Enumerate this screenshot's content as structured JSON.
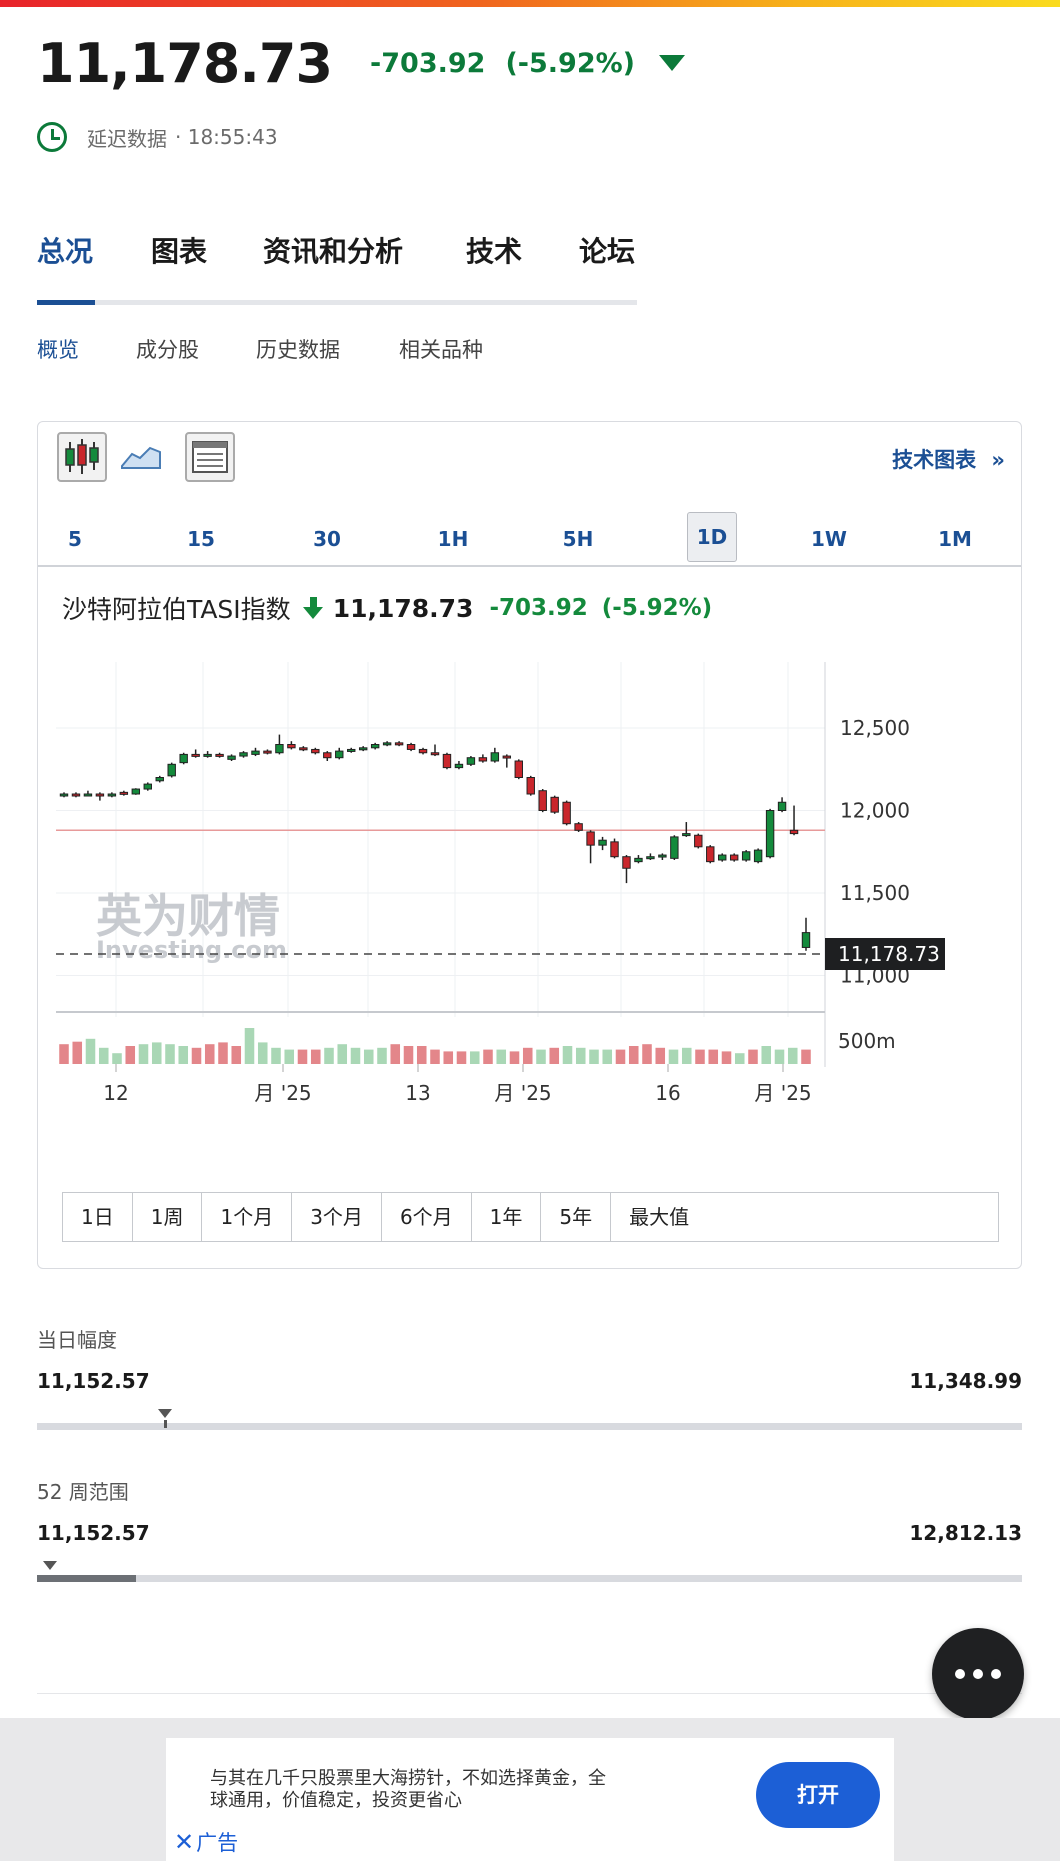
{
  "header": {
    "price": "11,178.73",
    "change": "-703.92",
    "change_pct": "(-5.92%)",
    "delay_label": "延迟数据",
    "time": "· 18:55:43"
  },
  "main_tabs": [
    "总况",
    "图表",
    "资讯和分析",
    "技术",
    "论坛"
  ],
  "sub_tabs": [
    "概览",
    "成分股",
    "历史数据",
    "相关品种"
  ],
  "chart_toolbar": {
    "tech_chart_label": "技术图表",
    "intervals": [
      "5",
      "15",
      "30",
      "1H",
      "5H",
      "1D",
      "1W",
      "1M"
    ],
    "selected_interval": "1D"
  },
  "chart_header": {
    "name": "沙特阿拉伯TASI指数",
    "price": "11,178.73",
    "change": "-703.92",
    "change_pct": "(-5.92%)"
  },
  "ranges": [
    "1日",
    "1周",
    "1个月",
    "3个月",
    "6个月",
    "1年",
    "5年",
    "最大值"
  ],
  "chart_data": {
    "type": "candlestick",
    "y_ticks": [
      "12,500",
      "12,000",
      "11,500",
      "11,000"
    ],
    "volume_tick": "500m",
    "x_ticks": [
      "12",
      "月 '25",
      "13",
      "月 '25",
      "16",
      "月 '25"
    ],
    "current_price_label": "11,178.73",
    "reference_line": 11880,
    "ylim": [
      10900,
      12900
    ],
    "candles": [
      {
        "o": 12090,
        "c": 12100,
        "h": 12110,
        "l": 12080
      },
      {
        "o": 12100,
        "c": 12090,
        "h": 12110,
        "l": 12080
      },
      {
        "o": 12095,
        "c": 12100,
        "h": 12120,
        "l": 12090
      },
      {
        "o": 12100,
        "c": 12090,
        "h": 12110,
        "l": 12060
      },
      {
        "o": 12090,
        "c": 12100,
        "h": 12110,
        "l": 12080
      },
      {
        "o": 12110,
        "c": 12100,
        "h": 12120,
        "l": 12090
      },
      {
        "o": 12100,
        "c": 12130,
        "h": 12135,
        "l": 12095
      },
      {
        "o": 12130,
        "c": 12160,
        "h": 12170,
        "l": 12120
      },
      {
        "o": 12180,
        "c": 12200,
        "h": 12210,
        "l": 12170
      },
      {
        "o": 12210,
        "c": 12280,
        "h": 12290,
        "l": 12200
      },
      {
        "o": 12290,
        "c": 12340,
        "h": 12350,
        "l": 12280
      },
      {
        "o": 12340,
        "c": 12330,
        "h": 12370,
        "l": 12320
      },
      {
        "o": 12330,
        "c": 12340,
        "h": 12360,
        "l": 12320
      },
      {
        "o": 12340,
        "c": 12330,
        "h": 12350,
        "l": 12320
      },
      {
        "o": 12310,
        "c": 12330,
        "h": 12340,
        "l": 12300
      },
      {
        "o": 12330,
        "c": 12350,
        "h": 12360,
        "l": 12320
      },
      {
        "o": 12340,
        "c": 12360,
        "h": 12380,
        "l": 12330
      },
      {
        "o": 12360,
        "c": 12350,
        "h": 12370,
        "l": 12340
      },
      {
        "o": 12350,
        "c": 12400,
        "h": 12460,
        "l": 12340
      },
      {
        "o": 12400,
        "c": 12380,
        "h": 12420,
        "l": 12370
      },
      {
        "o": 12380,
        "c": 12370,
        "h": 12390,
        "l": 12360
      },
      {
        "o": 12370,
        "c": 12350,
        "h": 12380,
        "l": 12340
      },
      {
        "o": 12350,
        "c": 12320,
        "h": 12360,
        "l": 12300
      },
      {
        "o": 12320,
        "c": 12360,
        "h": 12380,
        "l": 12310
      },
      {
        "o": 12360,
        "c": 12370,
        "h": 12380,
        "l": 12350
      },
      {
        "o": 12370,
        "c": 12380,
        "h": 12390,
        "l": 12360
      },
      {
        "o": 12380,
        "c": 12400,
        "h": 12410,
        "l": 12370
      },
      {
        "o": 12400,
        "c": 12410,
        "h": 12420,
        "l": 12390
      },
      {
        "o": 12410,
        "c": 12400,
        "h": 12420,
        "l": 12390
      },
      {
        "o": 12400,
        "c": 12370,
        "h": 12410,
        "l": 12360
      },
      {
        "o": 12370,
        "c": 12350,
        "h": 12380,
        "l": 12340
      },
      {
        "o": 12350,
        "c": 12340,
        "h": 12400,
        "l": 12330
      },
      {
        "o": 12340,
        "c": 12260,
        "h": 12350,
        "l": 12250
      },
      {
        "o": 12260,
        "c": 12280,
        "h": 12300,
        "l": 12250
      },
      {
        "o": 12280,
        "c": 12320,
        "h": 12330,
        "l": 12270
      },
      {
        "o": 12320,
        "c": 12300,
        "h": 12340,
        "l": 12290
      },
      {
        "o": 12300,
        "c": 12350,
        "h": 12380,
        "l": 12290
      },
      {
        "o": 12330,
        "c": 12320,
        "h": 12340,
        "l": 12260
      },
      {
        "o": 12300,
        "c": 12200,
        "h": 12310,
        "l": 12190
      },
      {
        "o": 12200,
        "c": 12100,
        "h": 12210,
        "l": 12090
      },
      {
        "o": 12120,
        "c": 12000,
        "h": 12130,
        "l": 11990
      },
      {
        "o": 12080,
        "c": 11990,
        "h": 12090,
        "l": 11980
      },
      {
        "o": 12050,
        "c": 11920,
        "h": 12060,
        "l": 11910
      },
      {
        "o": 11920,
        "c": 11880,
        "h": 11930,
        "l": 11870
      },
      {
        "o": 11870,
        "c": 11790,
        "h": 11880,
        "l": 11680
      },
      {
        "o": 11790,
        "c": 11820,
        "h": 11840,
        "l": 11760
      },
      {
        "o": 11810,
        "c": 11720,
        "h": 11830,
        "l": 11710
      },
      {
        "o": 11720,
        "c": 11650,
        "h": 11730,
        "l": 11560
      },
      {
        "o": 11690,
        "c": 11710,
        "h": 11730,
        "l": 11680
      },
      {
        "o": 11710,
        "c": 11720,
        "h": 11740,
        "l": 11700
      },
      {
        "o": 11720,
        "c": 11730,
        "h": 11740,
        "l": 11700
      },
      {
        "o": 11710,
        "c": 11840,
        "h": 11850,
        "l": 11700
      },
      {
        "o": 11850,
        "c": 11860,
        "h": 11930,
        "l": 11840
      },
      {
        "o": 11850,
        "c": 11780,
        "h": 11860,
        "l": 11770
      },
      {
        "o": 11780,
        "c": 11690,
        "h": 11790,
        "l": 11680
      },
      {
        "o": 11700,
        "c": 11730,
        "h": 11740,
        "l": 11690
      },
      {
        "o": 11730,
        "c": 11700,
        "h": 11740,
        "l": 11690
      },
      {
        "o": 11700,
        "c": 11750,
        "h": 11760,
        "l": 11690
      },
      {
        "o": 11690,
        "c": 11760,
        "h": 11770,
        "l": 11680
      },
      {
        "o": 11720,
        "c": 12000,
        "h": 12010,
        "l": 11710
      },
      {
        "o": 12000,
        "c": 12050,
        "h": 12080,
        "l": 11990
      },
      {
        "o": 11880,
        "c": 11860,
        "h": 12030,
        "l": 11850
      },
      {
        "o": 11170,
        "c": 11260,
        "h": 11350,
        "l": 11150
      }
    ],
    "volumes": [
      {
        "v": 0.55,
        "up": false
      },
      {
        "v": 0.62,
        "up": false
      },
      {
        "v": 0.7,
        "up": true
      },
      {
        "v": 0.45,
        "up": true
      },
      {
        "v": 0.3,
        "up": true
      },
      {
        "v": 0.5,
        "up": false
      },
      {
        "v": 0.55,
        "up": true
      },
      {
        "v": 0.6,
        "up": true
      },
      {
        "v": 0.55,
        "up": true
      },
      {
        "v": 0.5,
        "up": true
      },
      {
        "v": 0.45,
        "up": false
      },
      {
        "v": 0.55,
        "up": false
      },
      {
        "v": 0.6,
        "up": false
      },
      {
        "v": 0.5,
        "up": false
      },
      {
        "v": 1.0,
        "up": true
      },
      {
        "v": 0.6,
        "up": true
      },
      {
        "v": 0.45,
        "up": true
      },
      {
        "v": 0.4,
        "up": true
      },
      {
        "v": 0.4,
        "up": false
      },
      {
        "v": 0.4,
        "up": false
      },
      {
        "v": 0.45,
        "up": true
      },
      {
        "v": 0.55,
        "up": true
      },
      {
        "v": 0.45,
        "up": true
      },
      {
        "v": 0.4,
        "up": true
      },
      {
        "v": 0.45,
        "up": true
      },
      {
        "v": 0.55,
        "up": false
      },
      {
        "v": 0.5,
        "up": false
      },
      {
        "v": 0.5,
        "up": false
      },
      {
        "v": 0.4,
        "up": false
      },
      {
        "v": 0.35,
        "up": false
      },
      {
        "v": 0.35,
        "up": false
      },
      {
        "v": 0.35,
        "up": true
      },
      {
        "v": 0.4,
        "up": false
      },
      {
        "v": 0.4,
        "up": true
      },
      {
        "v": 0.35,
        "up": false
      },
      {
        "v": 0.45,
        "up": false
      },
      {
        "v": 0.4,
        "up": true
      },
      {
        "v": 0.45,
        "up": false
      },
      {
        "v": 0.5,
        "up": true
      },
      {
        "v": 0.45,
        "up": true
      },
      {
        "v": 0.4,
        "up": true
      },
      {
        "v": 0.4,
        "up": true
      },
      {
        "v": 0.4,
        "up": false
      },
      {
        "v": 0.5,
        "up": false
      },
      {
        "v": 0.55,
        "up": false
      },
      {
        "v": 0.45,
        "up": false
      },
      {
        "v": 0.4,
        "up": true
      },
      {
        "v": 0.45,
        "up": true
      },
      {
        "v": 0.4,
        "up": false
      },
      {
        "v": 0.4,
        "up": false
      },
      {
        "v": 0.35,
        "up": false
      },
      {
        "v": 0.3,
        "up": true
      },
      {
        "v": 0.4,
        "up": false
      },
      {
        "v": 0.5,
        "up": true
      },
      {
        "v": 0.4,
        "up": true
      },
      {
        "v": 0.45,
        "up": true
      },
      {
        "v": 0.4,
        "up": false
      }
    ]
  },
  "day_range": {
    "label": "当日幅度",
    "low": "11,152.57",
    "high": "11,348.99",
    "position": 0.13
  },
  "week52_range": {
    "label": "52 周范围",
    "low": "11,152.57",
    "high": "12,812.13",
    "position": 0.013,
    "fill": 0.1
  },
  "ad": {
    "text": "与其在几千只股票里大海捞针，不如选择黄金，全球通用，价值稳定，投资更省心",
    "open_label": "打开",
    "close_label": "广告"
  },
  "colors": {
    "accent": "#1b4f94",
    "up": "#148a3c",
    "down": "#c9262c",
    "ad_button": "#1c5fd6"
  }
}
